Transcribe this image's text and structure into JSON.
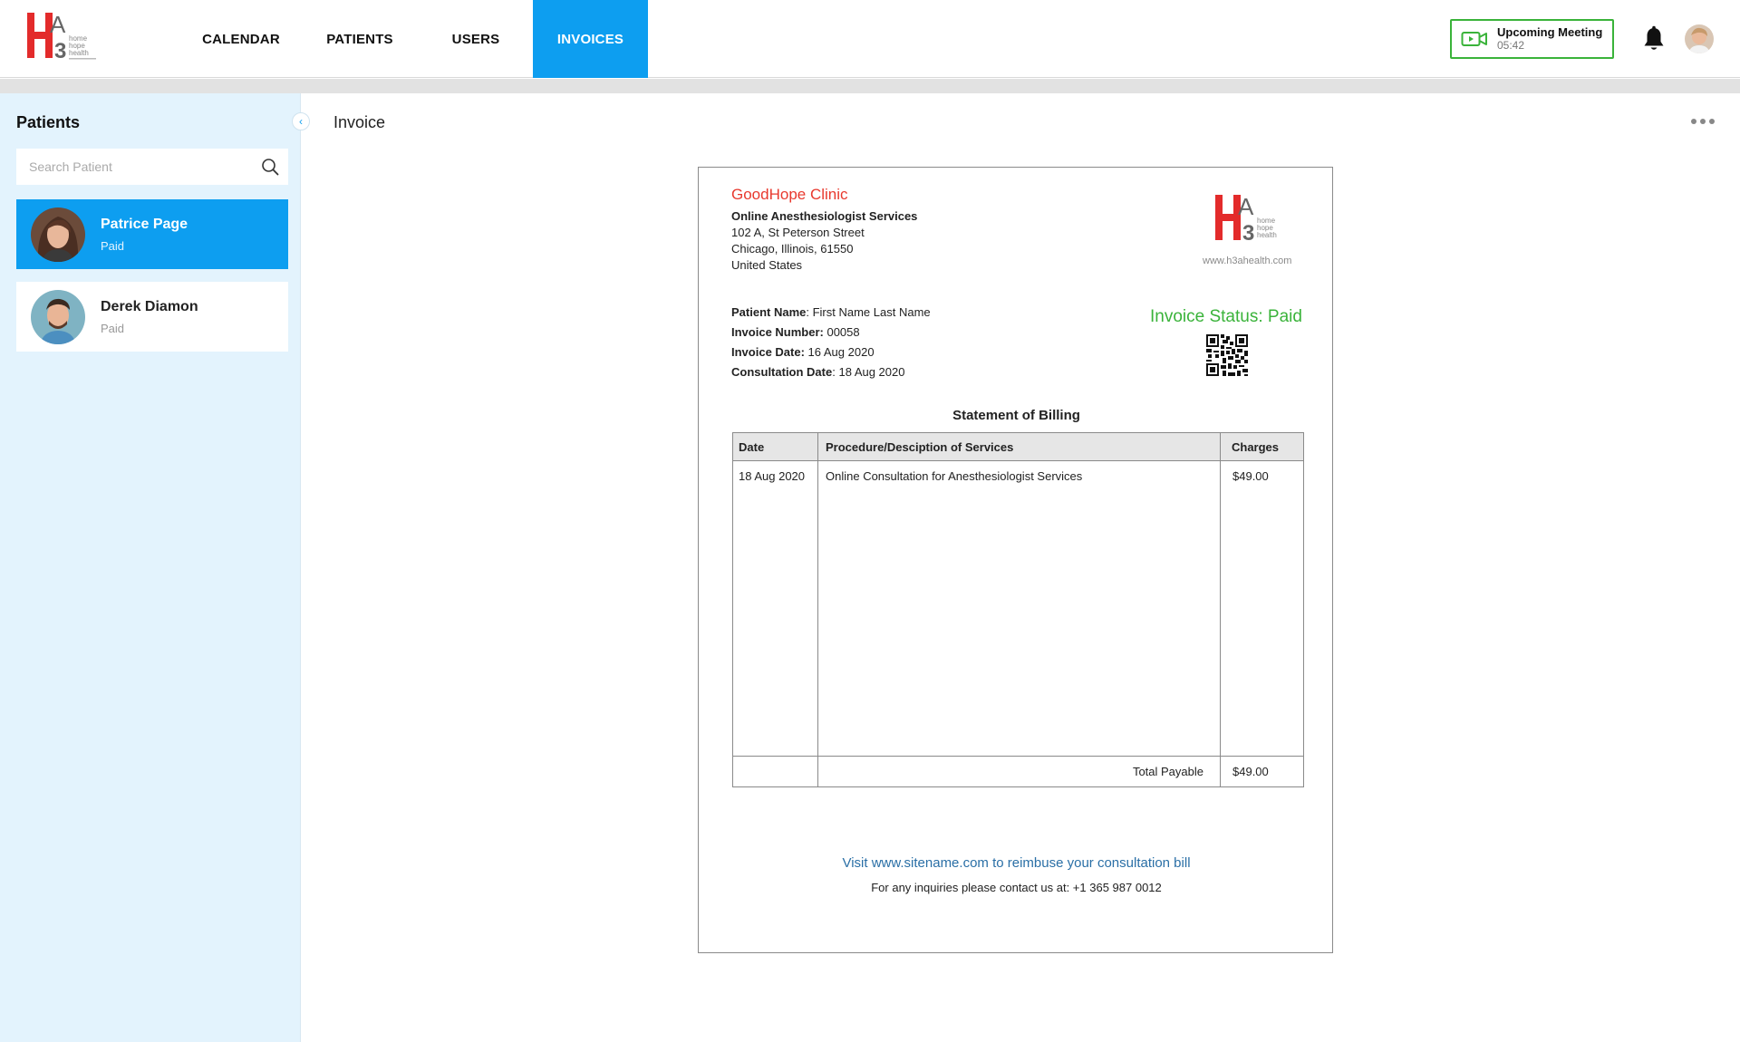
{
  "brand": {
    "logo_name": "h3a-logo",
    "logo_text": "home hope health",
    "accent": "#0d9ef0",
    "logo_red": "#e32b2b"
  },
  "nav": {
    "items": [
      {
        "label": "CALENDAR",
        "active": false
      },
      {
        "label": "PATIENTS",
        "active": false
      },
      {
        "label": "USERS",
        "active": false
      },
      {
        "label": "INVOICES",
        "active": true
      }
    ]
  },
  "meeting": {
    "title": "Upcoming Meeting",
    "time": "05:42",
    "icon": "video-camera-icon",
    "color": "#3ab33a"
  },
  "header_icons": {
    "bell": "bell-icon",
    "avatar": "user-avatar"
  },
  "sidebar": {
    "title": "Patients",
    "search_placeholder": "Search Patient",
    "patients": [
      {
        "name": "Patrice Page",
        "status": "Paid",
        "selected": true
      },
      {
        "name": "Derek Diamon",
        "status": "Paid",
        "selected": false
      }
    ]
  },
  "main": {
    "title": "Invoice"
  },
  "invoice": {
    "clinic_name": "GoodHope Clinic",
    "service": "Online Anesthesiologist Services",
    "address": [
      "102 A, St Peterson Street",
      "Chicago, Illinois, 61550",
      "United States"
    ],
    "website": "www.h3ahealth.com",
    "fields": [
      {
        "label": "Patient Name",
        "value": ": First Name Last Name"
      },
      {
        "label": "Invoice Number:",
        "value": " 00058"
      },
      {
        "label": "Invoice Date:",
        "value": " 16 Aug 2020"
      },
      {
        "label": "Consultation Date",
        "value": ": 18 Aug 2020"
      }
    ],
    "status_text": "Invoice Status: Paid",
    "statement_title": "Statement of Billing",
    "table": {
      "headers": [
        "Date",
        "Procedure/Desciption of Services",
        "Charges"
      ],
      "rows": [
        {
          "date": "18 Aug 2020",
          "description": "Online Consultation for Anesthesiologist Services",
          "charge": "$49.00"
        }
      ],
      "total_label": "Total Payable",
      "total_value": "$49.00"
    },
    "visit_text": "Visit www.sitename.com to reimbuse your consultation bill",
    "contact_text": "For any inquiries please contact us at: +1 365 987 0012"
  }
}
